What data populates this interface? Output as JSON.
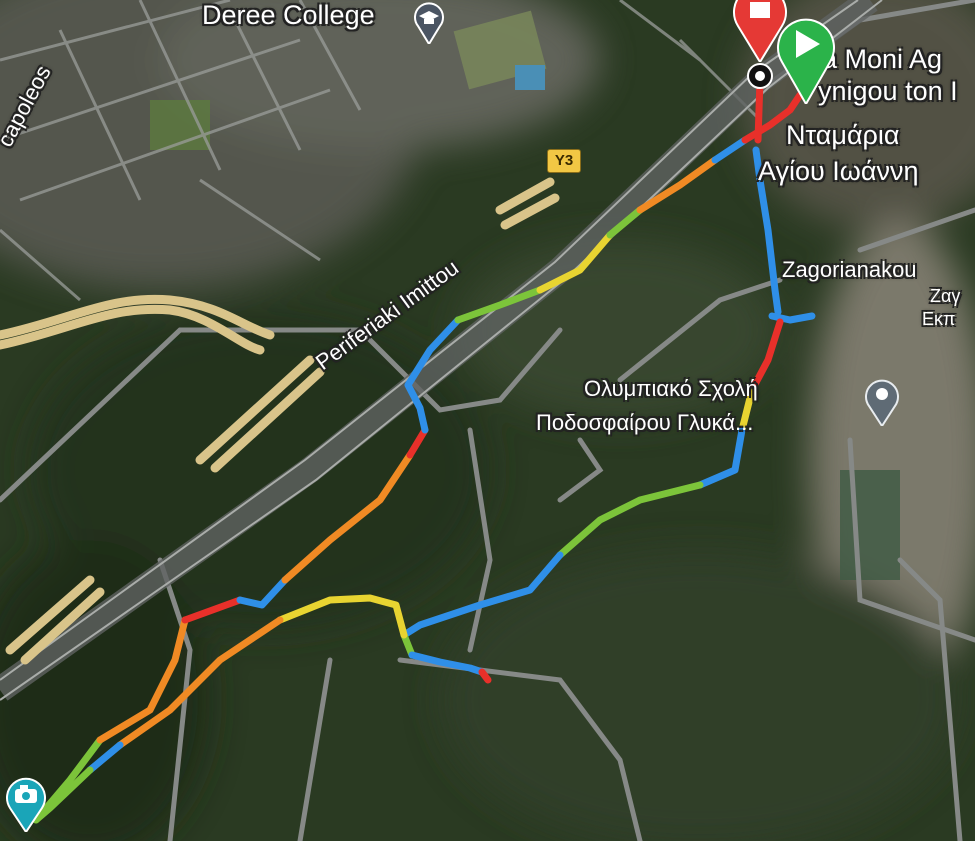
{
  "map": {
    "colors": {
      "forest": "#2a3a22",
      "road": "#7a7d7c",
      "highway": "#d9c48a",
      "route_red": "#e8302a",
      "route_orange": "#f08a24",
      "route_yellow": "#e8d431",
      "route_green": "#7cc43a",
      "route_blue": "#2f8fe8"
    },
    "labels": {
      "deree_college": "Deree College",
      "street_left": "capoleos",
      "highway_marker": "Υ3",
      "perifereiaki": "Periferiaki Imittou",
      "moni_line1": "a Moni Ag",
      "moni_line2": "ynigou ton I",
      "ntamaria_line1": "Νταμάρια",
      "ntamaria_line2": "Αγίου Ιωάννη",
      "zagorianakou": "Zagorianakou",
      "zag_greek": "Ζαγ",
      "ekp_greek": "Εκπ",
      "olymp_line1": "Ολυμπιακό  Σχολή",
      "olymp_line2": "Ποδοσφαίρου Γλυκά..."
    },
    "icons": {
      "school": "graduation-cap-icon",
      "poi": "place-pin-icon",
      "finish": "finish-flag-marker",
      "start": "start-play-marker",
      "photo": "camera-icon"
    }
  }
}
